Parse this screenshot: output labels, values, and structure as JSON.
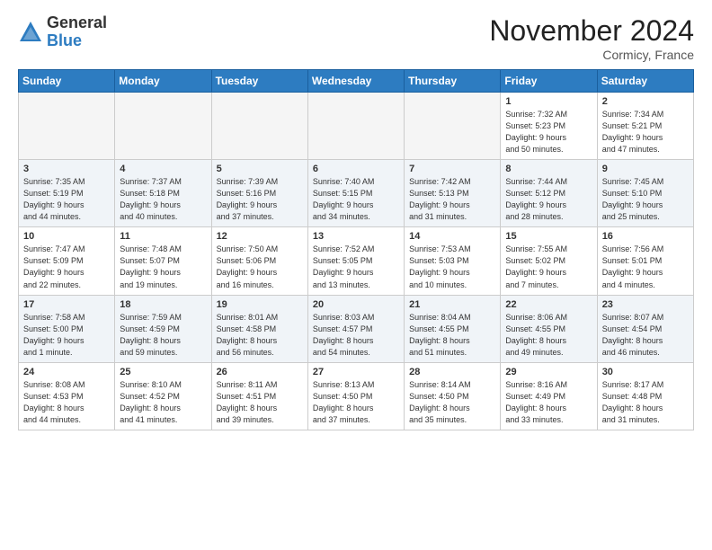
{
  "logo": {
    "general": "General",
    "blue": "Blue"
  },
  "title": "November 2024",
  "subtitle": "Cormicy, France",
  "days_of_week": [
    "Sunday",
    "Monday",
    "Tuesday",
    "Wednesday",
    "Thursday",
    "Friday",
    "Saturday"
  ],
  "weeks": [
    {
      "days": [
        {
          "num": "",
          "info": ""
        },
        {
          "num": "",
          "info": ""
        },
        {
          "num": "",
          "info": ""
        },
        {
          "num": "",
          "info": ""
        },
        {
          "num": "",
          "info": ""
        },
        {
          "num": "1",
          "info": "Sunrise: 7:32 AM\nSunset: 5:23 PM\nDaylight: 9 hours\nand 50 minutes."
        },
        {
          "num": "2",
          "info": "Sunrise: 7:34 AM\nSunset: 5:21 PM\nDaylight: 9 hours\nand 47 minutes."
        }
      ]
    },
    {
      "days": [
        {
          "num": "3",
          "info": "Sunrise: 7:35 AM\nSunset: 5:19 PM\nDaylight: 9 hours\nand 44 minutes."
        },
        {
          "num": "4",
          "info": "Sunrise: 7:37 AM\nSunset: 5:18 PM\nDaylight: 9 hours\nand 40 minutes."
        },
        {
          "num": "5",
          "info": "Sunrise: 7:39 AM\nSunset: 5:16 PM\nDaylight: 9 hours\nand 37 minutes."
        },
        {
          "num": "6",
          "info": "Sunrise: 7:40 AM\nSunset: 5:15 PM\nDaylight: 9 hours\nand 34 minutes."
        },
        {
          "num": "7",
          "info": "Sunrise: 7:42 AM\nSunset: 5:13 PM\nDaylight: 9 hours\nand 31 minutes."
        },
        {
          "num": "8",
          "info": "Sunrise: 7:44 AM\nSunset: 5:12 PM\nDaylight: 9 hours\nand 28 minutes."
        },
        {
          "num": "9",
          "info": "Sunrise: 7:45 AM\nSunset: 5:10 PM\nDaylight: 9 hours\nand 25 minutes."
        }
      ]
    },
    {
      "days": [
        {
          "num": "10",
          "info": "Sunrise: 7:47 AM\nSunset: 5:09 PM\nDaylight: 9 hours\nand 22 minutes."
        },
        {
          "num": "11",
          "info": "Sunrise: 7:48 AM\nSunset: 5:07 PM\nDaylight: 9 hours\nand 19 minutes."
        },
        {
          "num": "12",
          "info": "Sunrise: 7:50 AM\nSunset: 5:06 PM\nDaylight: 9 hours\nand 16 minutes."
        },
        {
          "num": "13",
          "info": "Sunrise: 7:52 AM\nSunset: 5:05 PM\nDaylight: 9 hours\nand 13 minutes."
        },
        {
          "num": "14",
          "info": "Sunrise: 7:53 AM\nSunset: 5:03 PM\nDaylight: 9 hours\nand 10 minutes."
        },
        {
          "num": "15",
          "info": "Sunrise: 7:55 AM\nSunset: 5:02 PM\nDaylight: 9 hours\nand 7 minutes."
        },
        {
          "num": "16",
          "info": "Sunrise: 7:56 AM\nSunset: 5:01 PM\nDaylight: 9 hours\nand 4 minutes."
        }
      ]
    },
    {
      "days": [
        {
          "num": "17",
          "info": "Sunrise: 7:58 AM\nSunset: 5:00 PM\nDaylight: 9 hours\nand 1 minute."
        },
        {
          "num": "18",
          "info": "Sunrise: 7:59 AM\nSunset: 4:59 PM\nDaylight: 8 hours\nand 59 minutes."
        },
        {
          "num": "19",
          "info": "Sunrise: 8:01 AM\nSunset: 4:58 PM\nDaylight: 8 hours\nand 56 minutes."
        },
        {
          "num": "20",
          "info": "Sunrise: 8:03 AM\nSunset: 4:57 PM\nDaylight: 8 hours\nand 54 minutes."
        },
        {
          "num": "21",
          "info": "Sunrise: 8:04 AM\nSunset: 4:55 PM\nDaylight: 8 hours\nand 51 minutes."
        },
        {
          "num": "22",
          "info": "Sunrise: 8:06 AM\nSunset: 4:55 PM\nDaylight: 8 hours\nand 49 minutes."
        },
        {
          "num": "23",
          "info": "Sunrise: 8:07 AM\nSunset: 4:54 PM\nDaylight: 8 hours\nand 46 minutes."
        }
      ]
    },
    {
      "days": [
        {
          "num": "24",
          "info": "Sunrise: 8:08 AM\nSunset: 4:53 PM\nDaylight: 8 hours\nand 44 minutes."
        },
        {
          "num": "25",
          "info": "Sunrise: 8:10 AM\nSunset: 4:52 PM\nDaylight: 8 hours\nand 41 minutes."
        },
        {
          "num": "26",
          "info": "Sunrise: 8:11 AM\nSunset: 4:51 PM\nDaylight: 8 hours\nand 39 minutes."
        },
        {
          "num": "27",
          "info": "Sunrise: 8:13 AM\nSunset: 4:50 PM\nDaylight: 8 hours\nand 37 minutes."
        },
        {
          "num": "28",
          "info": "Sunrise: 8:14 AM\nSunset: 4:50 PM\nDaylight: 8 hours\nand 35 minutes."
        },
        {
          "num": "29",
          "info": "Sunrise: 8:16 AM\nSunset: 4:49 PM\nDaylight: 8 hours\nand 33 minutes."
        },
        {
          "num": "30",
          "info": "Sunrise: 8:17 AM\nSunset: 4:48 PM\nDaylight: 8 hours\nand 31 minutes."
        }
      ]
    }
  ]
}
